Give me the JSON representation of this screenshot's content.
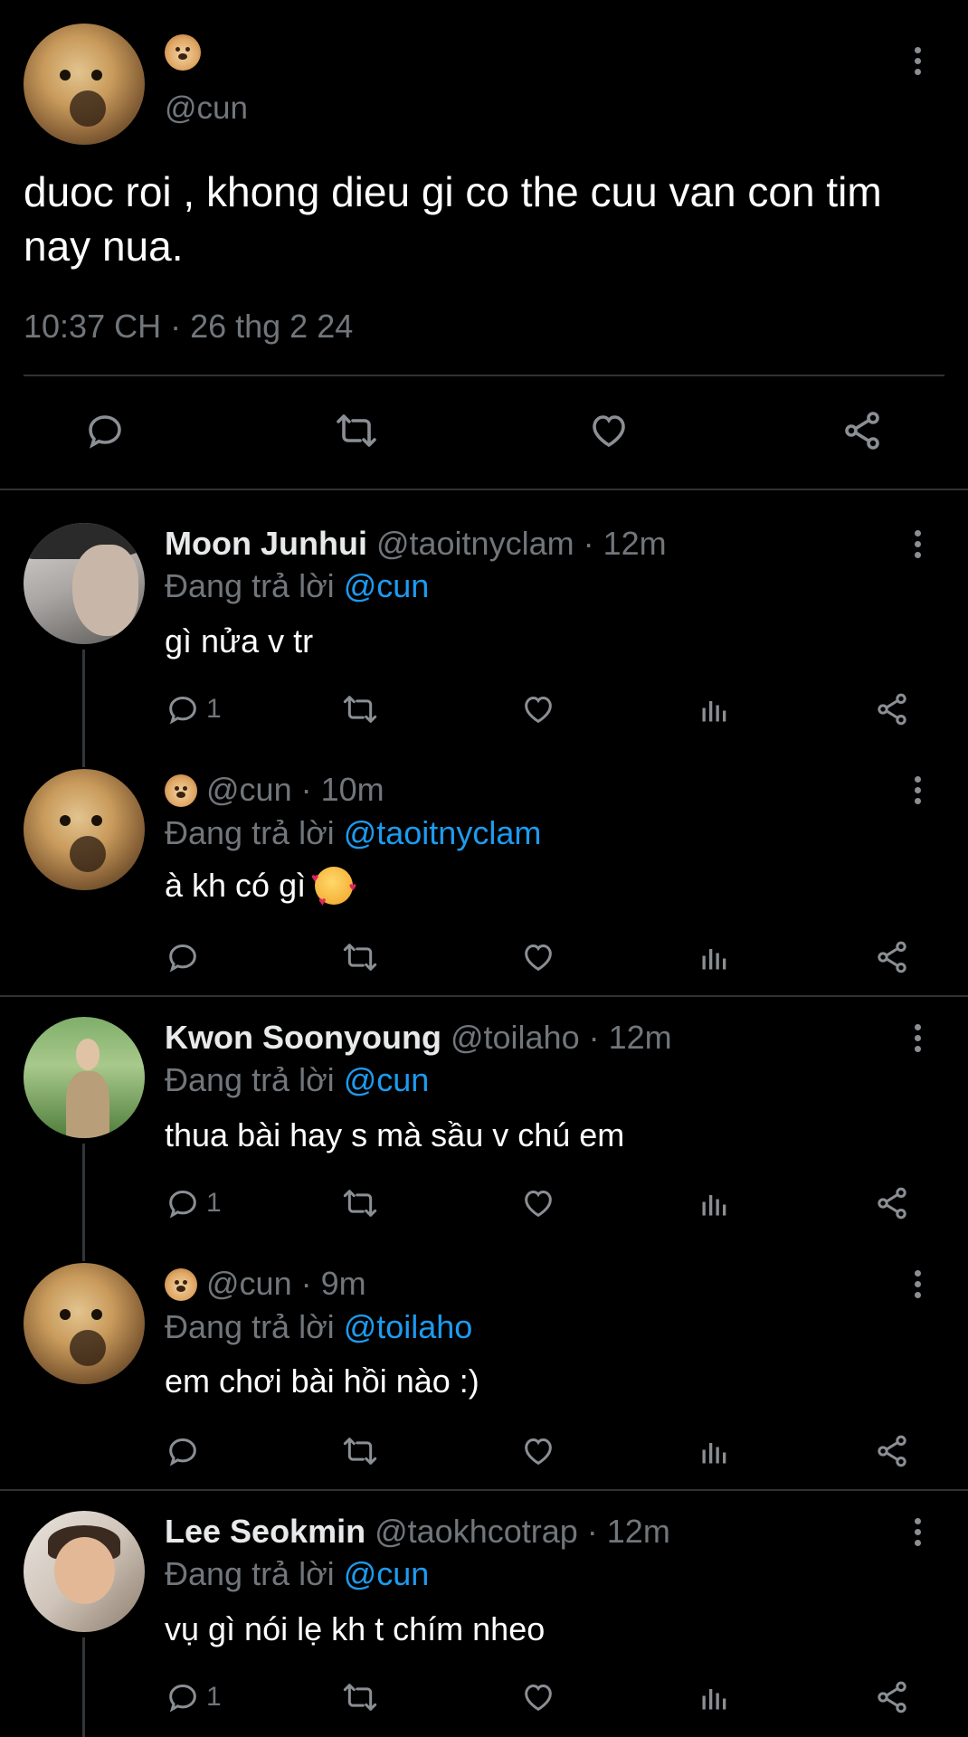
{
  "main_post": {
    "username": "@cun",
    "text": "duoc roi , khong dieu gi co the cuu van con tim nay nua.",
    "timestamp": "10:37 CH · 26 thg 2 24"
  },
  "replies": [
    {
      "display_name": "Moon Junhui",
      "handle": "@taoitnyclam",
      "time": "· 12m",
      "replying_prefix": "Đang trả lời",
      "replying_to": "@cun",
      "text": "gì nửa v tr",
      "reply_count": "1"
    },
    {
      "display_name": "",
      "handle": "@cun",
      "time": "· 10m",
      "replying_prefix": "Đang trả lời",
      "replying_to": "@taoitnyclam",
      "text": "à kh có gì",
      "reply_count": ""
    },
    {
      "display_name": "Kwon Soonyoung",
      "handle": "@toilaho",
      "time": "· 12m",
      "replying_prefix": "Đang trả lời",
      "replying_to": "@cun",
      "text": "thua bài hay s mà sầu v chú em",
      "reply_count": "1"
    },
    {
      "display_name": "",
      "handle": "@cun",
      "time": "· 9m",
      "replying_prefix": "Đang trả lời",
      "replying_to": "@toilaho",
      "text": "em chơi bài hồi nào :)",
      "reply_count": ""
    },
    {
      "display_name": "Lee Seokmin",
      "handle": "@taokhcotrap",
      "time": "· 12m",
      "replying_prefix": "Đang trả lời",
      "replying_to": "@cun",
      "text": "vụ gì nói lẹ kh t chím nheo",
      "reply_count": "1"
    }
  ],
  "icons": {
    "reply": "reply-icon",
    "retweet": "retweet-icon",
    "like": "heart-icon",
    "views": "views-icon",
    "share": "share-icon",
    "more": "more-icon"
  },
  "colors": {
    "background": "#000000",
    "text": "#e7e9ea",
    "muted": "#71767b",
    "link": "#1d9bf0"
  }
}
